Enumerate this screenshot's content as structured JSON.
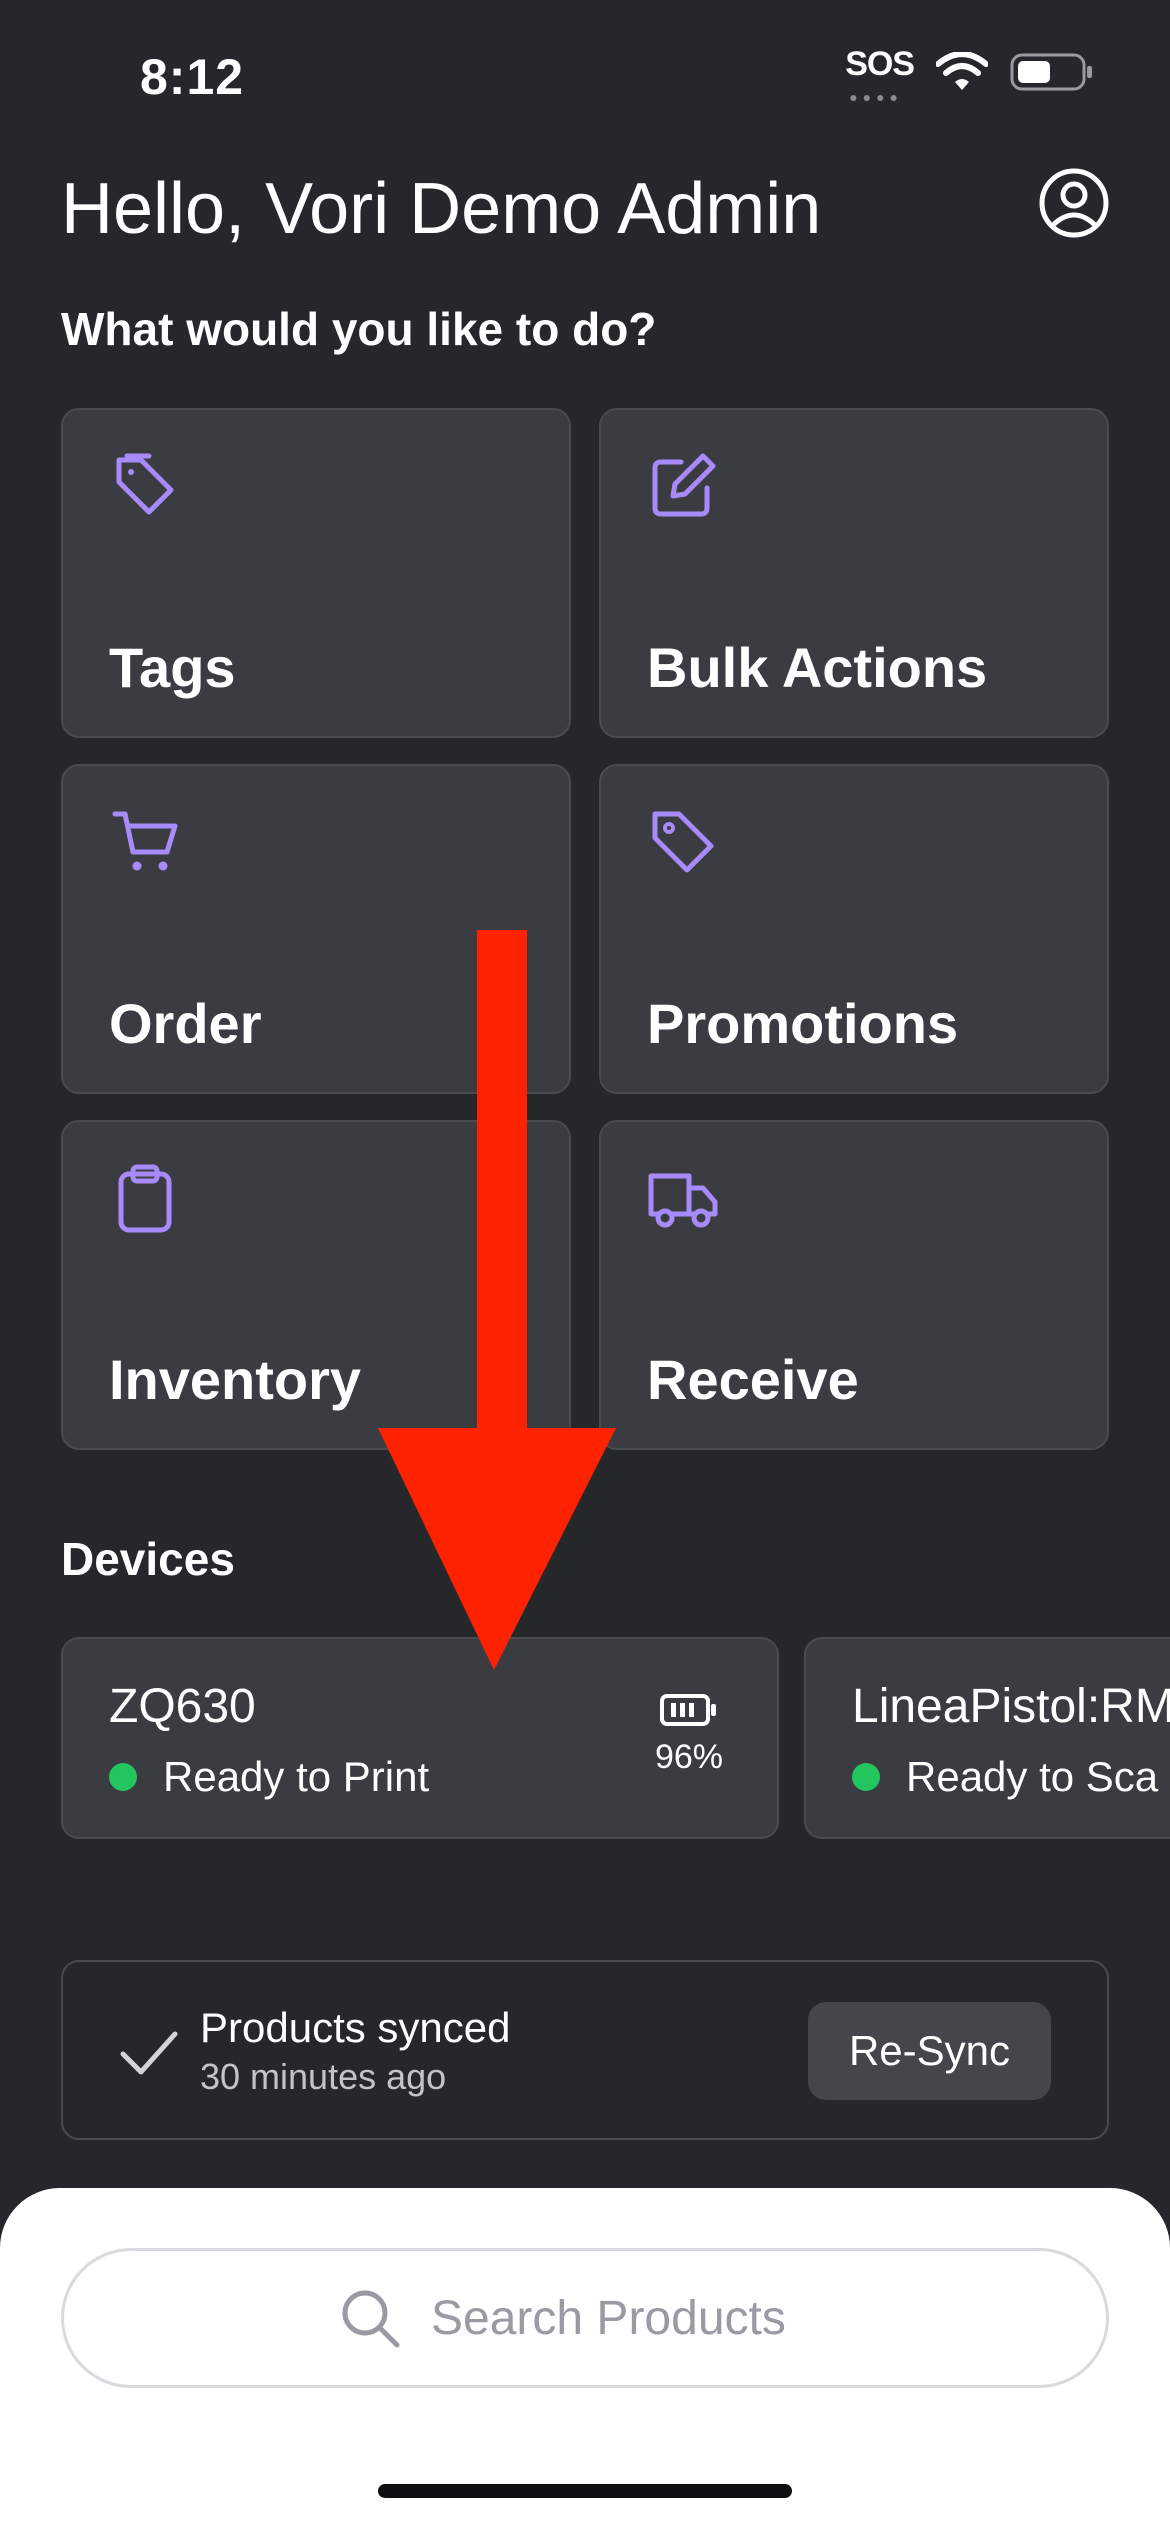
{
  "status_bar": {
    "time": "8:12",
    "sos": "SOS"
  },
  "header": {
    "greeting": "Hello, Vori Demo Admin",
    "prompt": "What would you like to do?"
  },
  "tiles": [
    {
      "label": "Tags",
      "icon": "tags-icon"
    },
    {
      "label": "Bulk Actions",
      "icon": "edit-icon"
    },
    {
      "label": "Order",
      "icon": "cart-icon"
    },
    {
      "label": "Promotions",
      "icon": "tag-icon"
    },
    {
      "label": "Inventory",
      "icon": "clipboard-icon"
    },
    {
      "label": "Receive",
      "icon": "truck-icon"
    }
  ],
  "devices": {
    "title": "Devices",
    "items": [
      {
        "name": "ZQ630",
        "status": "Ready to Print",
        "battery": "96%"
      },
      {
        "name": "LineaPistol:RM",
        "status": "Ready to Sca"
      }
    ]
  },
  "sync": {
    "title": "Products synced",
    "subtitle": "30 minutes ago",
    "button": "Re-Sync"
  },
  "search": {
    "placeholder": "Search Products"
  },
  "colors": {
    "background": "#26272b",
    "card": "#3b3c41",
    "accent_icon": "#a78bfa",
    "status_ok": "#22c55e",
    "annotation": "#ff2200"
  }
}
